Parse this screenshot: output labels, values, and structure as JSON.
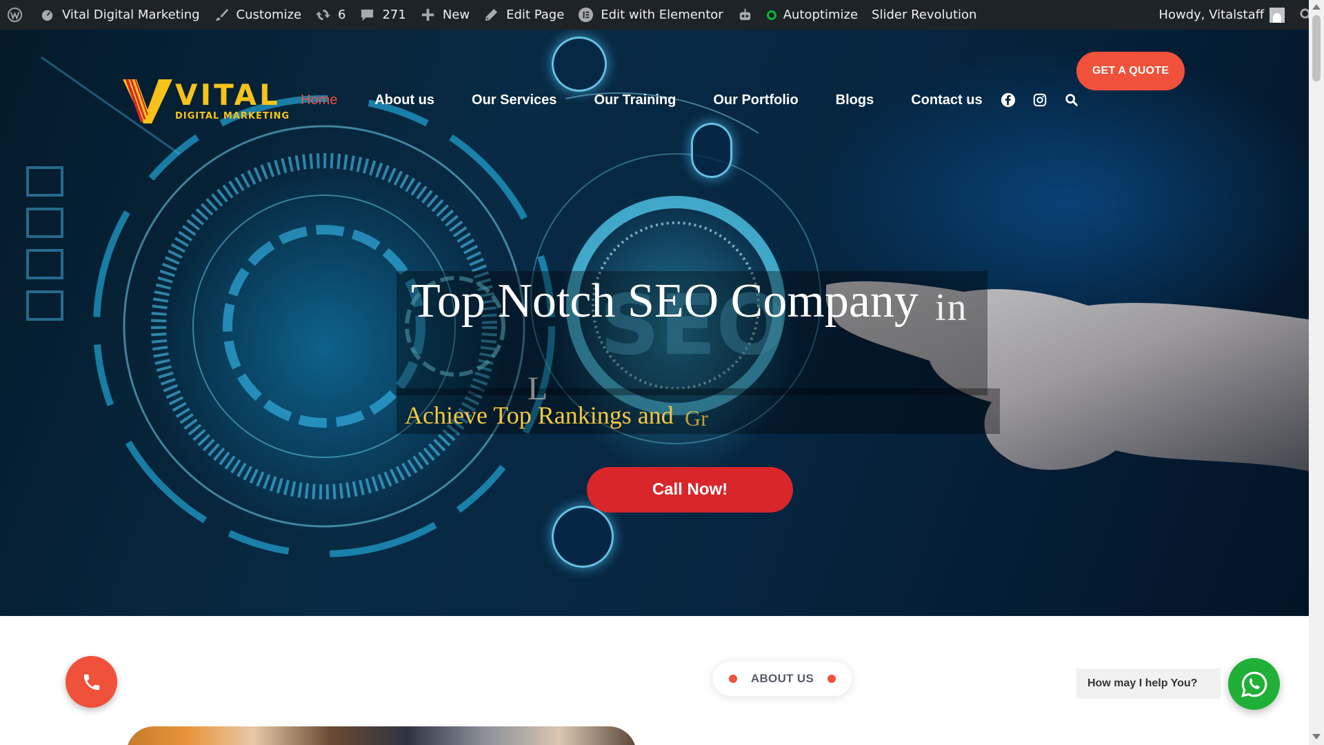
{
  "admin_bar": {
    "site_name": "Vital Digital Marketing",
    "customize": "Customize",
    "updates_count": "6",
    "comments_count": "271",
    "new_label": "New",
    "edit_page": "Edit Page",
    "edit_elementor": "Edit with Elementor",
    "autoptimize": "Autoptimize",
    "slider_revolution": "Slider Revolution",
    "howdy": "Howdy, Vitalstaff"
  },
  "logo": {
    "word": "VITAL",
    "sub": "DIGITAL MARKETING"
  },
  "nav": {
    "items": [
      "Home",
      "About us",
      "Our Services",
      "Our Training",
      "Our Portfolio",
      "Blogs",
      "Contact us"
    ],
    "active": "Home",
    "icons": [
      "facebook-icon",
      "instagram-icon",
      "search-icon"
    ]
  },
  "header": {
    "quote_button": "GET A QUOTE"
  },
  "hero": {
    "title": "Top Notch SEO Company",
    "title_tail": "in",
    "ghost_letters": "L",
    "subtitle": "Achieve Top Rankings and",
    "subtitle_tail": "Gr",
    "cta": "Call Now!"
  },
  "about": {
    "label": "ABOUT US"
  },
  "whatsapp": {
    "prompt": "How may I help You?"
  },
  "colors": {
    "accent": "#f0513a",
    "cta_red": "#d8262b",
    "logo_gold": "#f6c21b",
    "subtitle_gold": "#f5c842",
    "admin_bar": "#1d2327",
    "whatsapp_green": "#20b038"
  }
}
